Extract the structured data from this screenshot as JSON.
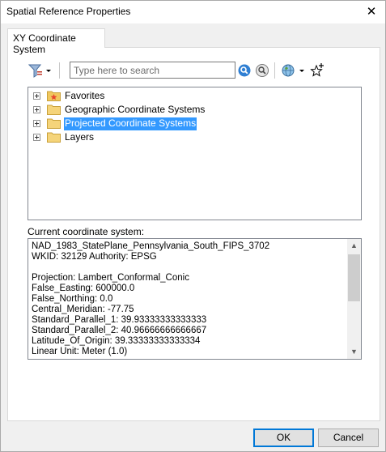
{
  "window": {
    "title": "Spatial Reference Properties"
  },
  "tabs": [
    {
      "label": "XY Coordinate System"
    }
  ],
  "toolbar": {
    "search_placeholder": "Type here to search"
  },
  "tree": {
    "items": [
      {
        "label": "Favorites"
      },
      {
        "label": "Geographic Coordinate Systems"
      },
      {
        "label": "Projected Coordinate Systems"
      },
      {
        "label": "Layers"
      }
    ]
  },
  "current": {
    "label": "Current coordinate system:",
    "lines": [
      "NAD_1983_StatePlane_Pennsylvania_South_FIPS_3702",
      "WKID: 32129 Authority: EPSG",
      "",
      "Projection: Lambert_Conformal_Conic",
      "False_Easting: 600000.0",
      "False_Northing: 0.0",
      "Central_Meridian: -77.75",
      "Standard_Parallel_1: 39.93333333333333",
      "Standard_Parallel_2: 40.96666666666667",
      "Latitude_Of_Origin: 39.33333333333334",
      "Linear Unit: Meter (1.0)"
    ]
  },
  "buttons": {
    "ok": "OK",
    "cancel": "Cancel"
  }
}
